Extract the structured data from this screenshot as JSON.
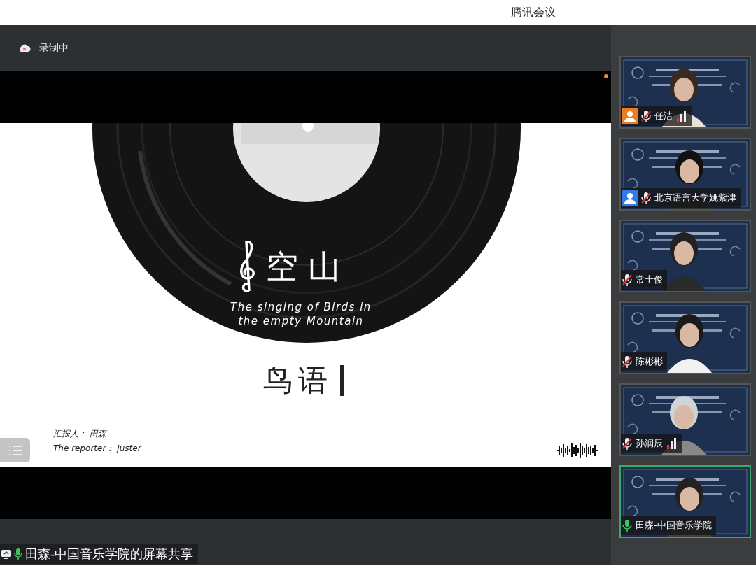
{
  "window": {
    "title": "腾讯会议"
  },
  "recording": {
    "label": "录制中"
  },
  "slide": {
    "title": "空山",
    "subtitle_lines": [
      "The singing of Birds in",
      "the empty Mountain"
    ],
    "second_title": "鸟语",
    "reporter_lines": [
      "汇报人： 田森",
      "The reporter： Juster"
    ]
  },
  "participants": [
    {
      "name": "任洁",
      "color": "#f07c1e",
      "muted": true,
      "network_icon": true,
      "active_speaker": false
    },
    {
      "name": "北京语言大学姚紫津",
      "color": "#2f7be8",
      "muted": true,
      "network_icon": false,
      "active_speaker": false
    },
    {
      "name": "常士俊",
      "muted": true,
      "network_icon": false,
      "active_speaker": false
    },
    {
      "name": "陈彬彬",
      "muted": true,
      "network_icon": false,
      "active_speaker": false
    },
    {
      "name": "孙润辰",
      "muted": true,
      "network_icon": true,
      "active_speaker": false
    },
    {
      "name": "田森-中国音乐学院",
      "muted": false,
      "network_icon": false,
      "active_speaker": true
    }
  ],
  "share_label": "田森-中国音乐学院的屏幕共享"
}
